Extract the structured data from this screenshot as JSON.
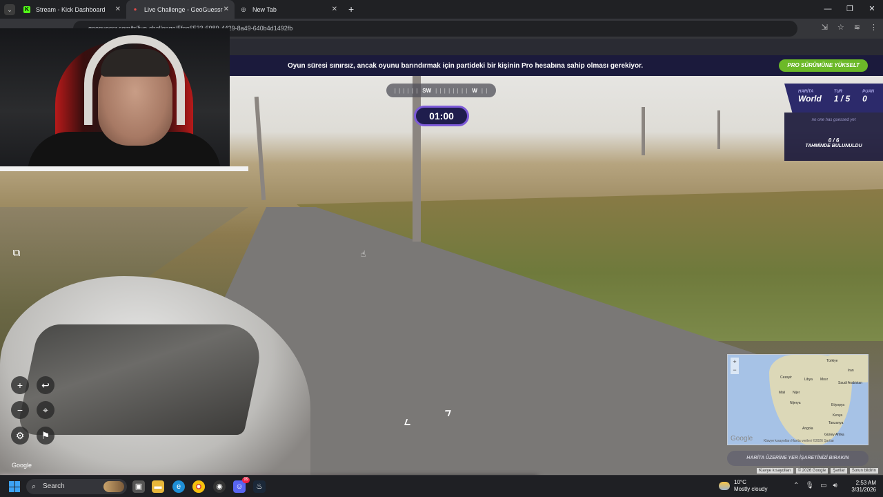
{
  "browser": {
    "tabs": [
      {
        "label": "Stream - Kick Dashboard",
        "icon": "kick-icon",
        "color": "#53fc18"
      },
      {
        "label": "Live Challenge - GeoGuessr",
        "icon": "geoguessr-pin-icon",
        "color": "#e04b4b"
      },
      {
        "label": "New Tab",
        "icon": "chrome-icon",
        "color": "#e8eaed"
      }
    ],
    "url": "geoguessr.com/tr/live-challenge/5fee6533-6989-4429-8a49-640b4d1492fb"
  },
  "banner": {
    "text": "Oyun süresi sınırsız, ancak oyunu barındırmak için partideki bir kişinin Pro hesabına sahip olması gerekiyor.",
    "pro_button": "PRO SÜRÜMÜNE YÜKSELT",
    "pro_color": "#6cb928"
  },
  "compass": {
    "left": "SW",
    "right": "W"
  },
  "timer": "01:00",
  "status": {
    "map_label": "HARİTA",
    "map_value": "World",
    "round_label": "TUR",
    "round_value": "1 / 5",
    "score_label": "PUAN",
    "score_value": "0",
    "no_guess": "no one has guessed yet",
    "found_count": "0 / 6",
    "found_label": "TAHMİNDE BULUNULDU"
  },
  "controls": {
    "zoom_in": "+",
    "zoom_out": "−",
    "undo": "↩",
    "pin": "⌖",
    "settings": "⚙",
    "flag": "⚑"
  },
  "google_watermark": "Google",
  "minimap": {
    "labels": [
      "Türkiye",
      "Iran",
      "Cezayir",
      "Libya",
      "Mısır",
      "Saudi Arabistan",
      "Mali",
      "Nijer",
      "Nijerya",
      "Etiyopya",
      "Kenya",
      "Tanzanya",
      "Angola",
      "Güney Afrika"
    ],
    "google": "Google",
    "footer": "Klavye kısayolları   Harita verileri ©2026   Şartlar",
    "place_guess": "HARİTA ÜZERİNE YER İŞARETİNİZİ BIRAKIN"
  },
  "footer_links": [
    "Klavye kısayolları",
    "© 2026 Google",
    "Şartlar",
    "Sorun bildirin"
  ],
  "taskbar": {
    "search": "Search",
    "weather_temp": "10°C",
    "weather_desc": "Mostly cloudy",
    "time": "2:53 AM",
    "date": "3/31/2026",
    "discord_badge": "99"
  }
}
